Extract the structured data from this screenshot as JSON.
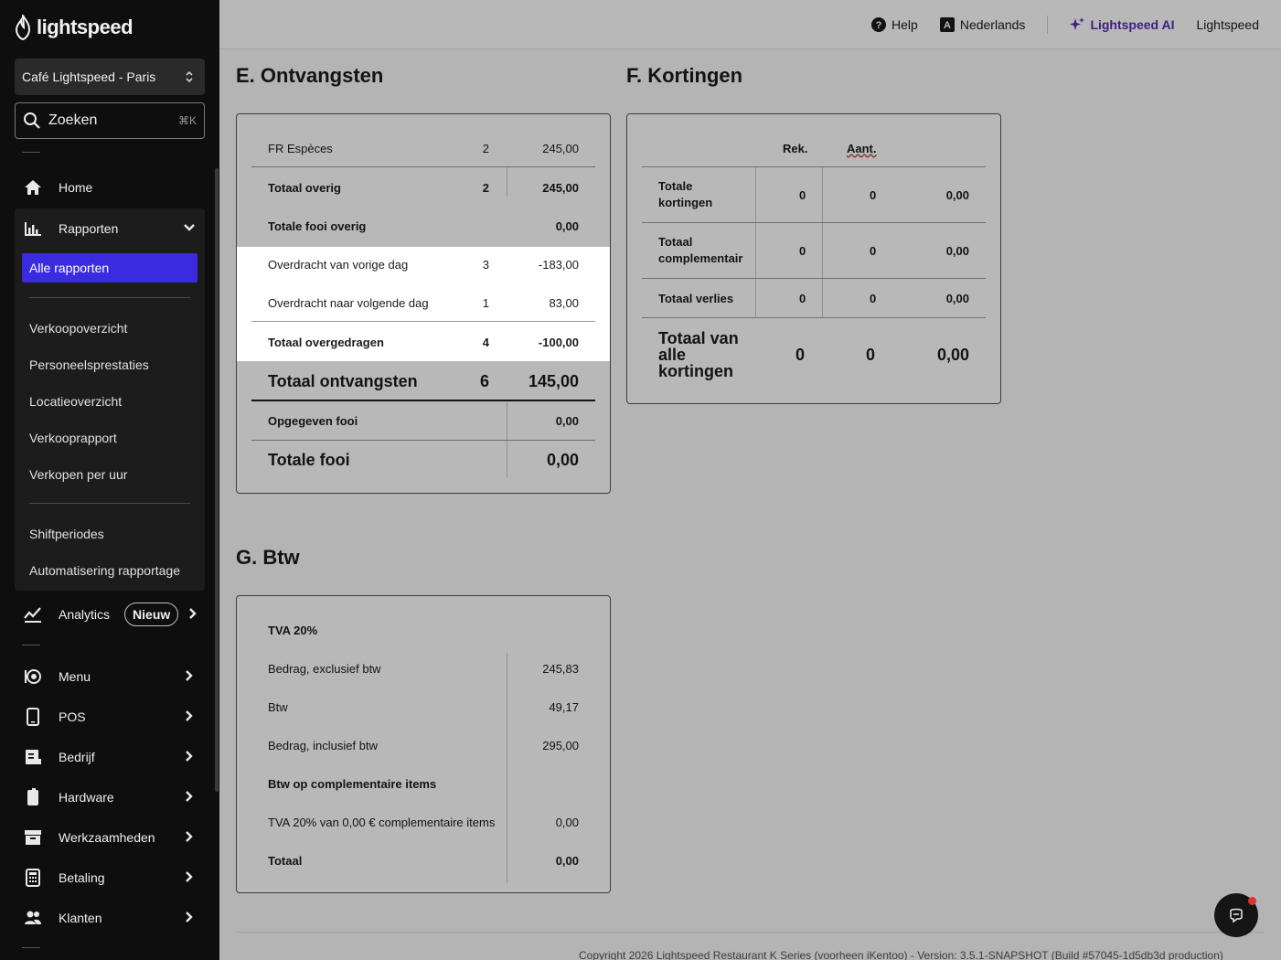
{
  "sidebar": {
    "logo": "lightspeed",
    "location": "Café Lightspeed - Paris",
    "search_placeholder": "Zoeken",
    "search_shortcut": "⌘K",
    "items": [
      {
        "label": "Home",
        "icon": "home-icon"
      },
      {
        "label": "Rapporten",
        "icon": "bar-chart-icon"
      },
      {
        "label": "Analytics",
        "icon": "trend-icon",
        "badge": "Nieuw"
      },
      {
        "label": "Menu",
        "icon": "menu-icon"
      },
      {
        "label": "POS",
        "icon": "tablet-icon"
      },
      {
        "label": "Bedrijf",
        "icon": "business-icon"
      },
      {
        "label": "Hardware",
        "icon": "hardware-icon"
      },
      {
        "label": "Werkzaamheden",
        "icon": "archive-icon"
      },
      {
        "label": "Betaling",
        "icon": "calculator-icon"
      },
      {
        "label": "Klanten",
        "icon": "users-icon"
      }
    ],
    "reports_sub": {
      "active": "Alle rapporten",
      "group1": [
        "Verkoopoverzicht",
        "Personeelsprestaties",
        "Locatieoverzicht",
        "Verkooprapport",
        "Verkopen per uur"
      ],
      "group2": [
        "Shiftperiodes",
        "Automatisering rapportage"
      ]
    }
  },
  "topbar": {
    "help": "Help",
    "language": "Nederlands",
    "ai": "Lightspeed AI",
    "account": "Lightspeed"
  },
  "sections": {
    "e_title": "E. Ontvangsten",
    "f_title": "F. Kortingen",
    "g_title": "G. Btw"
  },
  "ontvangsten": {
    "rows": [
      {
        "label": "FR Espèces",
        "count": "2",
        "amount": "245,00"
      },
      {
        "label": "Totaal overig",
        "count": "2",
        "amount": "245,00"
      },
      {
        "label": "Totale fooi overig",
        "count": "",
        "amount": "0,00"
      },
      {
        "label": "Overdracht van vorige dag",
        "count": "3",
        "amount": "-183,00"
      },
      {
        "label": "Overdracht naar volgende dag",
        "count": "1",
        "amount": "83,00"
      },
      {
        "label": "Totaal overgedragen",
        "count": "4",
        "amount": "-100,00"
      },
      {
        "label": "Totaal ontvangsten",
        "count": "6",
        "amount": "145,00"
      },
      {
        "label": "Opgegeven fooi",
        "count": "",
        "amount": "0,00"
      },
      {
        "label": "Totale fooi",
        "count": "",
        "amount": "0,00"
      }
    ]
  },
  "kortingen": {
    "headers": [
      "Rek.",
      "Aant."
    ],
    "rows": [
      {
        "label": "Totale kortingen",
        "rek": "0",
        "aant": "0",
        "amount": "0,00"
      },
      {
        "label": "Totaal complementair",
        "rek": "0",
        "aant": "0",
        "amount": "0,00"
      },
      {
        "label": "Totaal verlies",
        "rek": "0",
        "aant": "0",
        "amount": "0,00"
      },
      {
        "label": "Totaal van alle kortingen",
        "rek": "0",
        "aant": "0",
        "amount": "0,00"
      }
    ]
  },
  "btw": {
    "rows": [
      {
        "label": "TVA 20%",
        "amount": ""
      },
      {
        "label": "Bedrag, exclusief btw",
        "amount": "245,83"
      },
      {
        "label": "Btw",
        "amount": "49,17"
      },
      {
        "label": "Bedrag, inclusief btw",
        "amount": "295,00"
      },
      {
        "label": "Btw op complementaire items",
        "amount": ""
      },
      {
        "label": "TVA 20% van 0,00 € complementaire items",
        "amount": "0,00"
      },
      {
        "label": "Totaal",
        "amount": "0,00"
      }
    ]
  },
  "footer": "Copyright 2026 Lightspeed Restaurant K Series (voorheen iKentoo) - Version: 3.5.1-SNAPSHOT (Build #57045-1d5db3d production)"
}
